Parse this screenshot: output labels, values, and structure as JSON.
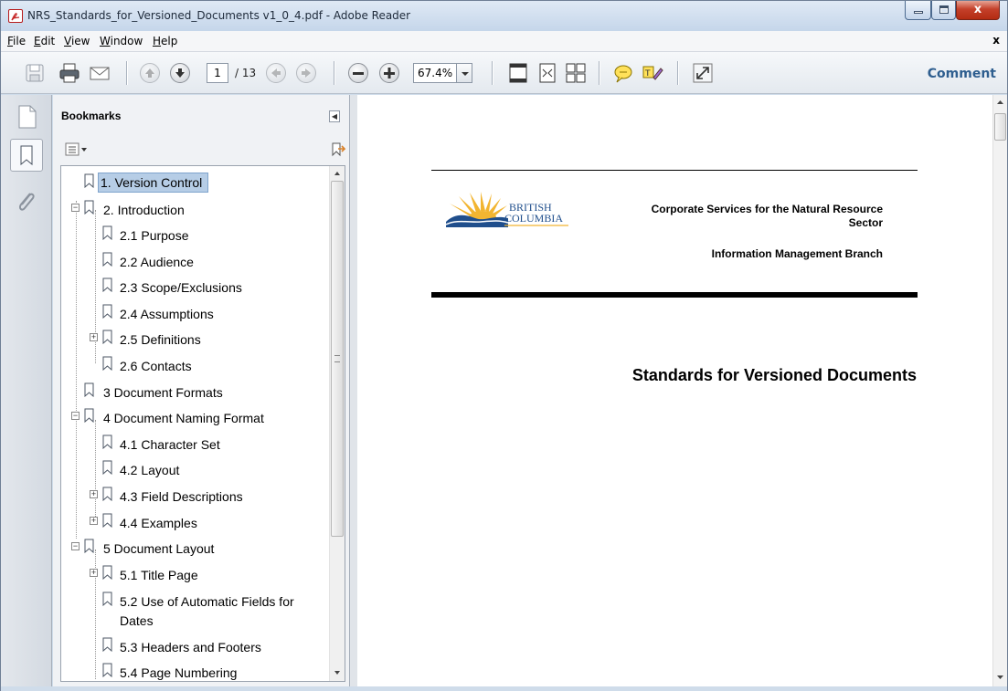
{
  "window": {
    "title": "NRS_Standards_for_Versioned_Documents v1_0_4.pdf - Adobe Reader",
    "close_glyph": "x"
  },
  "menubar": {
    "items": [
      {
        "label": "File",
        "key": "F"
      },
      {
        "label": "Edit",
        "key": "E"
      },
      {
        "label": "View",
        "key": "V"
      },
      {
        "label": "Window",
        "key": "W"
      },
      {
        "label": "Help",
        "key": "H"
      }
    ],
    "close_label": "x"
  },
  "toolbar": {
    "page_current": "1",
    "page_total": "/ 13",
    "zoom": "67.4%",
    "comment_label": "Comment",
    "icons": [
      "save-icon",
      "print-icon",
      "email-icon",
      "previous-page-icon",
      "next-page-icon",
      "first-page-icon",
      "last-page-icon",
      "zoom-out-icon",
      "zoom-in-icon",
      "fit-page-icon",
      "fit-width-icon",
      "two-up-icon",
      "comment-icon",
      "highlight-icon",
      "fullscreen-icon"
    ]
  },
  "sidebar": {
    "header": "Bookmarks",
    "icons": [
      "pages-icon",
      "bookmarks-icon",
      "attachments-icon"
    ],
    "bookmarks": [
      {
        "label": "1. Version Control",
        "level": 0,
        "expander": "",
        "selected": true
      },
      {
        "label": "2. Introduction",
        "level": 0,
        "expander": "-"
      },
      {
        "label": "2.1 Purpose",
        "level": 1,
        "expander": ""
      },
      {
        "label": "2.2 Audience",
        "level": 1,
        "expander": ""
      },
      {
        "label": "2.3 Scope/Exclusions",
        "level": 1,
        "expander": ""
      },
      {
        "label": "2.4 Assumptions",
        "level": 1,
        "expander": ""
      },
      {
        "label": "2.5 Definitions",
        "level": 1,
        "expander": "+"
      },
      {
        "label": "2.6 Contacts",
        "level": 1,
        "expander": ""
      },
      {
        "label": "3 Document Formats",
        "level": 0,
        "expander": ""
      },
      {
        "label": "4 Document Naming Format",
        "level": 0,
        "expander": "-"
      },
      {
        "label": "4.1 Character Set",
        "level": 1,
        "expander": ""
      },
      {
        "label": "4.2 Layout",
        "level": 1,
        "expander": ""
      },
      {
        "label": "4.3 Field Descriptions",
        "level": 1,
        "expander": "+"
      },
      {
        "label": "4.4 Examples",
        "level": 1,
        "expander": "+"
      },
      {
        "label": "5 Document Layout",
        "level": 0,
        "expander": "-"
      },
      {
        "label": "5.1 Title Page",
        "level": 1,
        "expander": "+"
      },
      {
        "label": "5.2 Use of Automatic Fields for",
        "label2": "Dates",
        "level": 1,
        "expander": ""
      },
      {
        "label": "5.3 Headers and Footers",
        "level": 1,
        "expander": ""
      },
      {
        "label": "5.4 Page Numbering",
        "level": 1,
        "expander": ""
      }
    ]
  },
  "document": {
    "logo_text_line1": "BRITISH",
    "logo_text_line2": "COLUMBIA",
    "corp_line1": "Corporate Services for the Natural Resource",
    "corp_line2": "Sector",
    "branch": "Information Management Branch",
    "title": "Standards for Versioned Documents"
  },
  "colors": {
    "accent": "#2e5e8f",
    "selection": "#b6cde6",
    "logo_gold": "#f2b531",
    "logo_blue": "#1f4e8c"
  }
}
